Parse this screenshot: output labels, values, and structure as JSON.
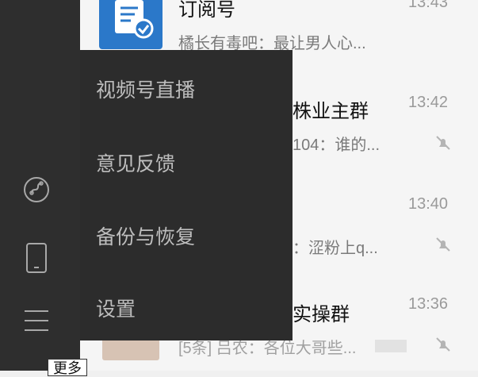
{
  "chats": [
    {
      "name": "订阅号",
      "preview": "橘长有毒吧：最让男人心...",
      "time": "13:43"
    },
    {
      "name": "株业主群",
      "preview": "104：谁的...",
      "time": "13:42"
    },
    {
      "name": "",
      "preview": "：涩粉上q...",
      "time": "13:40"
    },
    {
      "name": "实操群",
      "preview": "[5条] 吕农：各位大哥些...",
      "time": "13:36"
    }
  ],
  "menu": {
    "items": [
      {
        "label": "视频号直播"
      },
      {
        "label": "意见反馈"
      },
      {
        "label": "备份与恢复"
      },
      {
        "label": "设置"
      }
    ]
  },
  "tooltip": {
    "label": "更多"
  },
  "sidebar_icons": [
    "mini-program-icon",
    "phone-icon",
    "menu-icon"
  ],
  "colors": {
    "sidebar_bg": "#2e2e2e",
    "menu_bg": "#2c2c2c",
    "menu_text": "#bdbdbd",
    "subscription_avatar": "#2b78c9"
  }
}
